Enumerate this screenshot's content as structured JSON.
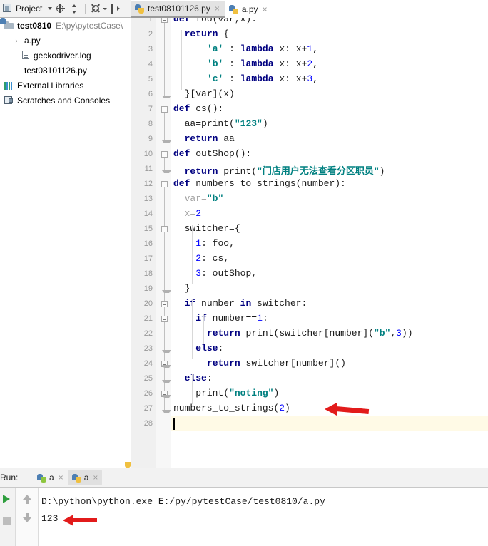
{
  "window": {
    "project_panel_title": "Project",
    "project_toolbar_icons": [
      "locate-icon",
      "collapse-all-icon",
      "settings-gear-icon",
      "hide-panel-icon"
    ]
  },
  "tabs": [
    {
      "label": "test08101126.py",
      "icon": "python-file-icon",
      "active": true,
      "close": "×"
    },
    {
      "label": "a.py",
      "icon": "python-file-icon",
      "active": false,
      "close": "×"
    }
  ],
  "tree": {
    "items": [
      {
        "label": "test0810",
        "path": "E:\\py\\pytestCase\\",
        "icon": "folder-icon",
        "indent": 0,
        "bold": true,
        "expander": ""
      },
      {
        "label": "a.py",
        "path": "",
        "icon": "python-file-icon",
        "indent": 1,
        "bold": false,
        "expander": "›"
      },
      {
        "label": "geckodriver.log",
        "path": "",
        "icon": "log-file-icon",
        "indent": 1,
        "bold": false,
        "expander": ""
      },
      {
        "label": "test08101126.py",
        "path": "",
        "icon": "python-file-icon",
        "indent": 1,
        "bold": false,
        "expander": ""
      },
      {
        "label": "External Libraries",
        "path": "",
        "icon": "library-icon",
        "indent": 0,
        "bold": false,
        "expander": ""
      },
      {
        "label": "Scratches and Consoles",
        "path": "",
        "icon": "scratches-icon",
        "indent": 0,
        "bold": false,
        "expander": ""
      }
    ]
  },
  "editor": {
    "current_line": 28,
    "lines": [
      {
        "n": 1,
        "indent": 0,
        "tokens": [
          {
            "t": "def ",
            "c": "kw"
          },
          {
            "t": "foo(var,x):",
            "c": ""
          }
        ]
      },
      {
        "n": 2,
        "indent": 1,
        "tokens": [
          {
            "t": "return ",
            "c": "kw"
          },
          {
            "t": "{",
            "c": ""
          }
        ]
      },
      {
        "n": 3,
        "indent": 3,
        "tokens": [
          {
            "t": "'a'",
            "c": "str"
          },
          {
            "t": " : ",
            "c": ""
          },
          {
            "t": "lambda ",
            "c": "kw"
          },
          {
            "t": "x: x+",
            "c": ""
          },
          {
            "t": "1",
            "c": "num"
          },
          {
            "t": ",",
            "c": ""
          }
        ]
      },
      {
        "n": 4,
        "indent": 3,
        "tokens": [
          {
            "t": "'b'",
            "c": "str"
          },
          {
            "t": " : ",
            "c": ""
          },
          {
            "t": "lambda ",
            "c": "kw"
          },
          {
            "t": "x: x+",
            "c": ""
          },
          {
            "t": "2",
            "c": "num"
          },
          {
            "t": ",",
            "c": ""
          }
        ]
      },
      {
        "n": 5,
        "indent": 3,
        "tokens": [
          {
            "t": "'c'",
            "c": "str"
          },
          {
            "t": " : ",
            "c": ""
          },
          {
            "t": "lambda ",
            "c": "kw"
          },
          {
            "t": "x: x+",
            "c": ""
          },
          {
            "t": "3",
            "c": "num"
          },
          {
            "t": ",",
            "c": ""
          }
        ]
      },
      {
        "n": 6,
        "indent": 1,
        "tokens": [
          {
            "t": "}[var](x)",
            "c": ""
          }
        ]
      },
      {
        "n": 7,
        "indent": 0,
        "tokens": [
          {
            "t": "def ",
            "c": "kw"
          },
          {
            "t": "cs():",
            "c": ""
          }
        ]
      },
      {
        "n": 8,
        "indent": 1,
        "tokens": [
          {
            "t": "aa=print(",
            "c": ""
          },
          {
            "t": "\"123\"",
            "c": "str"
          },
          {
            "t": ")",
            "c": ""
          }
        ]
      },
      {
        "n": 9,
        "indent": 1,
        "tokens": [
          {
            "t": "return ",
            "c": "kw"
          },
          {
            "t": "aa",
            "c": ""
          }
        ]
      },
      {
        "n": 10,
        "indent": 0,
        "tokens": [
          {
            "t": "def ",
            "c": "kw"
          },
          {
            "t": "outShop():",
            "c": ""
          }
        ]
      },
      {
        "n": 11,
        "indent": 1,
        "tokens": [
          {
            "t": "return ",
            "c": "kw"
          },
          {
            "t": "print(",
            "c": ""
          },
          {
            "t": "\"门店用户无法查看分区职员\"",
            "c": "str"
          },
          {
            "t": ")",
            "c": ""
          }
        ]
      },
      {
        "n": 12,
        "indent": 0,
        "tokens": [
          {
            "t": "def ",
            "c": "kw"
          },
          {
            "t": "numbers_to_strings(number):",
            "c": ""
          }
        ]
      },
      {
        "n": 13,
        "indent": 1,
        "tokens": [
          {
            "t": "var=",
            "c": "gray"
          },
          {
            "t": "\"b\"",
            "c": "str"
          }
        ]
      },
      {
        "n": 14,
        "indent": 1,
        "tokens": [
          {
            "t": "x=",
            "c": "gray"
          },
          {
            "t": "2",
            "c": "num"
          }
        ]
      },
      {
        "n": 15,
        "indent": 1,
        "tokens": [
          {
            "t": "switcher={",
            "c": ""
          }
        ]
      },
      {
        "n": 16,
        "indent": 2,
        "tokens": [
          {
            "t": "1",
            "c": "num"
          },
          {
            "t": ": foo,",
            "c": ""
          }
        ]
      },
      {
        "n": 17,
        "indent": 2,
        "tokens": [
          {
            "t": "2",
            "c": "num"
          },
          {
            "t": ": cs,",
            "c": ""
          }
        ]
      },
      {
        "n": 18,
        "indent": 2,
        "tokens": [
          {
            "t": "3",
            "c": "num"
          },
          {
            "t": ": outShop,",
            "c": ""
          }
        ]
      },
      {
        "n": 19,
        "indent": 1,
        "tokens": [
          {
            "t": "}",
            "c": ""
          }
        ]
      },
      {
        "n": 20,
        "indent": 1,
        "tokens": [
          {
            "t": "if ",
            "c": "kw"
          },
          {
            "t": "number ",
            "c": ""
          },
          {
            "t": "in ",
            "c": "kw"
          },
          {
            "t": "switcher:",
            "c": ""
          }
        ]
      },
      {
        "n": 21,
        "indent": 2,
        "tokens": [
          {
            "t": "if ",
            "c": "kw"
          },
          {
            "t": "number==",
            "c": ""
          },
          {
            "t": "1",
            "c": "num"
          },
          {
            "t": ":",
            "c": ""
          }
        ]
      },
      {
        "n": 22,
        "indent": 3,
        "tokens": [
          {
            "t": "return ",
            "c": "kw"
          },
          {
            "t": "print(switcher[number](",
            "c": ""
          },
          {
            "t": "\"b\"",
            "c": "str"
          },
          {
            "t": ",",
            "c": ""
          },
          {
            "t": "3",
            "c": "num"
          },
          {
            "t": "))",
            "c": ""
          }
        ]
      },
      {
        "n": 23,
        "indent": 2,
        "tokens": [
          {
            "t": "else",
            "c": "kw"
          },
          {
            "t": ":",
            "c": ""
          }
        ]
      },
      {
        "n": 24,
        "indent": 3,
        "tokens": [
          {
            "t": "return ",
            "c": "kw"
          },
          {
            "t": "switcher[number]()",
            "c": ""
          }
        ]
      },
      {
        "n": 25,
        "indent": 1,
        "tokens": [
          {
            "t": "else",
            "c": "kw"
          },
          {
            "t": ":",
            "c": ""
          }
        ]
      },
      {
        "n": 26,
        "indent": 2,
        "tokens": [
          {
            "t": "print(",
            "c": ""
          },
          {
            "t": "\"noting\"",
            "c": "str"
          },
          {
            "t": ")",
            "c": ""
          }
        ]
      },
      {
        "n": 27,
        "indent": 0,
        "tokens": [
          {
            "t": "numbers_to_strings(",
            "c": ""
          },
          {
            "t": "2",
            "c": "num"
          },
          {
            "t": ")",
            "c": ""
          }
        ]
      },
      {
        "n": 28,
        "indent": 0,
        "tokens": [
          {
            "t": "",
            "c": ""
          }
        ]
      }
    ]
  },
  "run_panel": {
    "label": "Run:",
    "tabs": [
      {
        "label": "a",
        "icon": "python-run-icon",
        "active": false,
        "close": "×"
      },
      {
        "label": "a",
        "icon": "python-run-icon",
        "active": true,
        "close": "×"
      }
    ],
    "toolbar_icons": [
      "rerun-play-icon",
      "stop-icon",
      "scroll-up-icon",
      "scroll-down-icon"
    ],
    "console_lines": [
      "D:\\python\\python.exe E:/py/pytestCase/test0810/a.py",
      "123"
    ]
  },
  "annotations": [
    {
      "name": "arrow-pointing-to-call-line",
      "target": "numbers_to_strings(2)",
      "color": "#e21b1b"
    },
    {
      "name": "arrow-pointing-to-output",
      "target": "123",
      "color": "#e21b1b"
    }
  ],
  "colors": {
    "keyword": "#000080",
    "string": "#008080",
    "number": "#0000ff",
    "annotation_red": "#e21b1b",
    "current_line_bg": "#fffae6"
  }
}
